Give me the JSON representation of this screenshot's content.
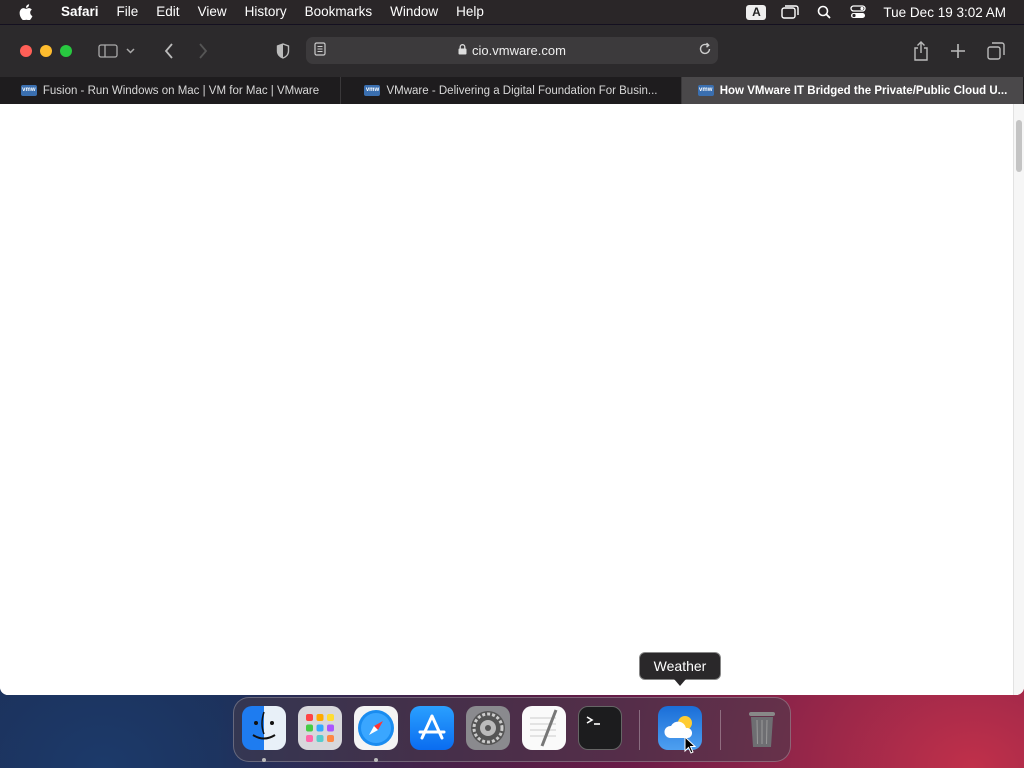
{
  "menubar": {
    "app_name": "Safari",
    "items": [
      "File",
      "Edit",
      "View",
      "History",
      "Bookmarks",
      "Window",
      "Help"
    ],
    "input_badge": "A",
    "clock": "Tue Dec 19  3:02 AM"
  },
  "toolbar": {
    "address": "cio.vmware.com"
  },
  "tabs": [
    {
      "title": "Fusion - Run Windows on Mac | VM for Mac | VMware",
      "favicon": "vmw"
    },
    {
      "title": "VMware - Delivering a Digital Foundation For Busin...",
      "favicon": "vmw"
    },
    {
      "title": "How VMware IT Bridged the Private/Public Cloud U...",
      "favicon": "vmw"
    }
  ],
  "dock": {
    "apps": [
      "Finder",
      "Launchpad",
      "Safari",
      "App Store",
      "System Preferences",
      "TextEdit",
      "Terminal",
      "Weather",
      "Trash"
    ],
    "tooltip": "Weather"
  },
  "colors": {
    "accent_blue": "#0a84ff",
    "traffic_red": "#ff5f57",
    "traffic_yellow": "#febc2e",
    "traffic_green": "#28c840"
  }
}
